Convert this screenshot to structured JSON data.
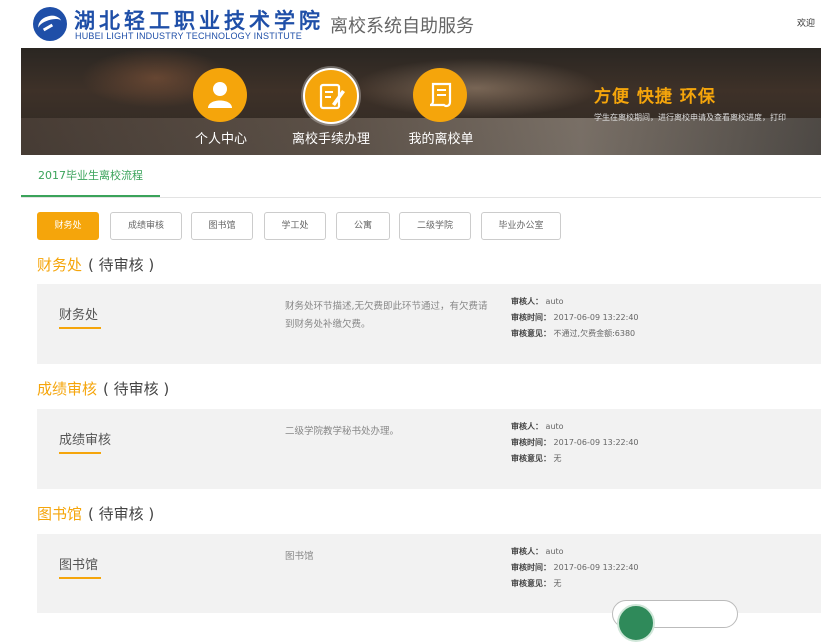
{
  "header": {
    "logo_cn": "湖北轻工职业技术学院",
    "logo_en": "HUBEI LIGHT INDUSTRY TECHNOLOGY INSTITUTE",
    "site_title": "离校系统自助服务",
    "welcome": "欢迎"
  },
  "banner": {
    "nav": [
      {
        "label": "个人中心",
        "icon": "user-icon"
      },
      {
        "label": "离校手续办理",
        "icon": "edit-document-icon",
        "active": true
      },
      {
        "label": "我的离校单",
        "icon": "scroll-icon"
      }
    ],
    "slogan": "方便 快捷 环保",
    "slogan_sub": "学生在离校期间，进行离校申请及查看离校进度，打印"
  },
  "tabs": [
    {
      "label": "2017毕业生离校流程",
      "active": true
    }
  ],
  "steps": [
    {
      "label": "财务处",
      "active": true
    },
    {
      "label": "成绩审核"
    },
    {
      "label": "图书馆"
    },
    {
      "label": "学工处"
    },
    {
      "label": "公寓"
    },
    {
      "label": "二级学院"
    },
    {
      "label": "毕业办公室"
    }
  ],
  "meta_labels": {
    "reviewer": "审核人：",
    "time": "审核时间：",
    "opinion": "审核意见："
  },
  "sections": [
    {
      "title": "财务处",
      "status": "( 待审核 )",
      "name": "财务处",
      "desc": "财务处环节描述,无欠费即此环节通过，有欠费请到财务处补缴欠费。",
      "reviewer": "auto",
      "time": "2017-06-09 13:22:40",
      "opinion": "不通过,欠费金额:6380"
    },
    {
      "title": "成绩审核",
      "status": "( 待审核 )",
      "name": "成绩审核",
      "desc": "二级学院教学秘书处办理。",
      "reviewer": "auto",
      "time": "2017-06-09 13:22:40",
      "opinion": "无"
    },
    {
      "title": "图书馆",
      "status": "( 待审核 )",
      "name": "图书馆",
      "desc": "图书馆",
      "reviewer": "auto",
      "time": "2017-06-09 13:22:40",
      "opinion": "无"
    }
  ],
  "colors": {
    "accent": "#f5a50b",
    "tab_green": "#3aa35a",
    "card_bg": "#f2f2f2"
  }
}
